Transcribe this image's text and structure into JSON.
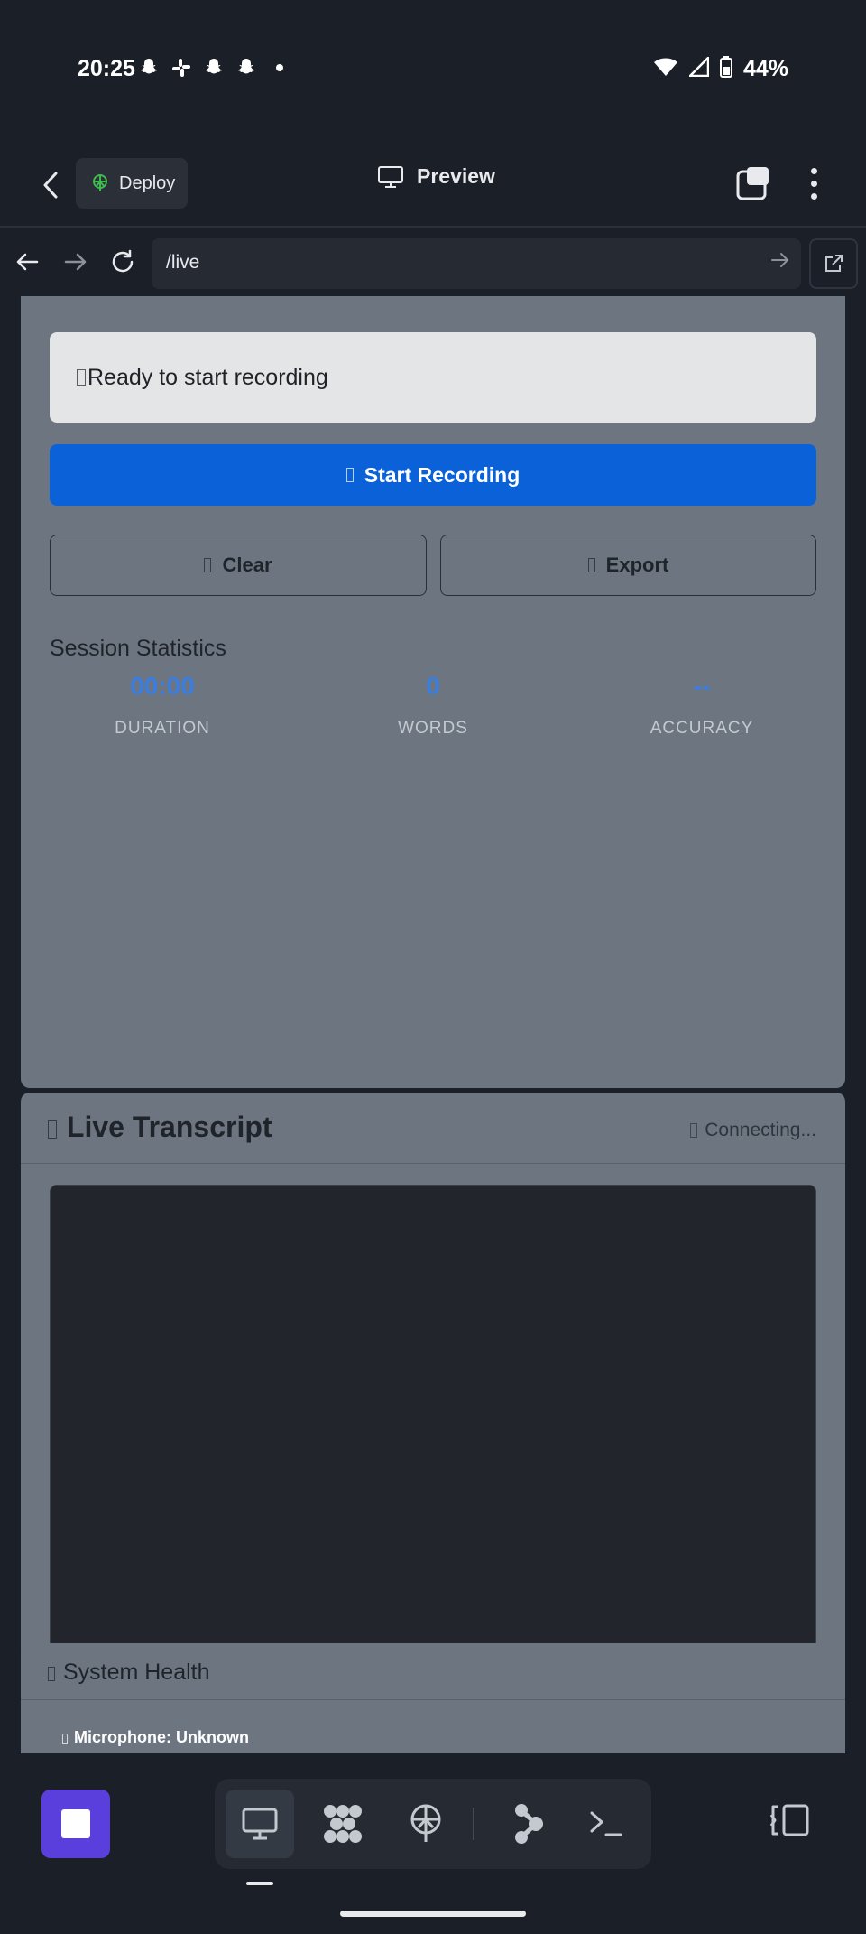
{
  "status_bar": {
    "time": "20:25",
    "battery": "44%",
    "notification_icons": [
      "snapchat-icon",
      "slack-icon",
      "snapchat-icon",
      "snapchat-icon"
    ]
  },
  "header": {
    "deploy_label": "Deploy",
    "title": "Preview"
  },
  "url_bar": {
    "path": "/live"
  },
  "controls": {
    "status_text": "Ready to start recording",
    "start_label": "Start Recording",
    "clear_label": "Clear",
    "export_label": "Export"
  },
  "stats": {
    "title": "Session Statistics",
    "items": [
      {
        "value": "00:00",
        "label": "DURATION"
      },
      {
        "value": "0",
        "label": "WORDS"
      },
      {
        "value": "--",
        "label": "ACCURACY"
      }
    ]
  },
  "transcript": {
    "title": "Live Transcript",
    "status": "Connecting..."
  },
  "system_health": {
    "title": "System Health",
    "microphone": "Microphone: Unknown"
  },
  "colors": {
    "accent_blue": "#0b62d8",
    "stat_blue": "#3b7ee0",
    "stop_purple": "#5b3fdc",
    "deploy_green": "#3fb950"
  }
}
